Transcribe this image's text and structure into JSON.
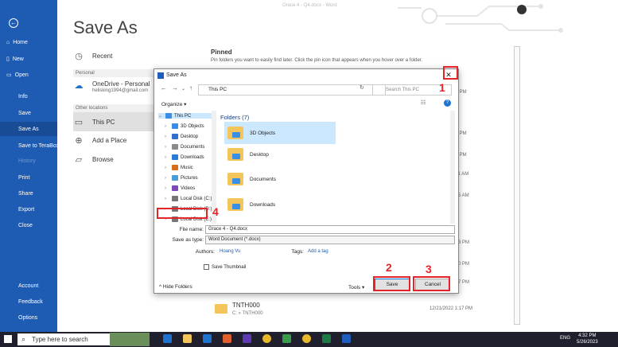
{
  "word": {
    "window_title": "Grace 4 - Q4.docx - Word",
    "page_title": "Save As",
    "sidebar": {
      "items": [
        {
          "label": "Home",
          "icon": "home-icon"
        },
        {
          "label": "New",
          "icon": "new-doc-icon"
        },
        {
          "label": "Open",
          "icon": "open-folder-icon"
        },
        {
          "label": "Info"
        },
        {
          "label": "Save"
        },
        {
          "label": "Save As"
        },
        {
          "label": "Save to TeraBox"
        },
        {
          "label": "History"
        },
        {
          "label": "Print"
        },
        {
          "label": "Share"
        },
        {
          "label": "Export"
        },
        {
          "label": "Close"
        },
        {
          "label": "Account"
        },
        {
          "label": "Feedback"
        },
        {
          "label": "Options"
        }
      ]
    },
    "locations": {
      "recent": "Recent",
      "personal_label": "Personal",
      "onedrive_name": "OneDrive - Personal",
      "onedrive_email": "helisking1994@gmail.com",
      "other_label": "Other locations",
      "this_pc": "This PC",
      "add_place": "Add a Place",
      "browse": "Browse"
    },
    "pinned": {
      "title": "Pinned",
      "subtitle": "Pin folders you want to easily find later. Click the pin icon that appears when you hover over a folder."
    },
    "side_times": [
      "... PM",
      "... PM",
      "... PM",
      ":11 AM",
      ":25 AM",
      ":13 PM",
      ":50 PM",
      ":17 PM"
    ],
    "recent_folder": {
      "name": "TNTH000",
      "path": "C: » TNTH000",
      "date": "12/21/2022 1:17 PM"
    }
  },
  "dialog": {
    "title": "Save As",
    "close": "✕",
    "address": "This PC",
    "search_placeholder": "Search This PC",
    "organize": "Organize ▾",
    "tree": [
      {
        "label": "This PC",
        "color": "#3a8ee6",
        "selected": true
      },
      {
        "label": "3D Objects",
        "color": "#3a8ee6"
      },
      {
        "label": "Desktop",
        "color": "#2f6fcf"
      },
      {
        "label": "Documents",
        "color": "#8a8a8a"
      },
      {
        "label": "Downloads",
        "color": "#2a7ad6"
      },
      {
        "label": "Music",
        "color": "#d86f1e"
      },
      {
        "label": "Pictures",
        "color": "#4a9cd6"
      },
      {
        "label": "Videos",
        "color": "#7b4ab8"
      },
      {
        "label": "Local Disk (C:)",
        "color": "#777777"
      },
      {
        "label": "Local Disk (D:)",
        "color": "#777777"
      },
      {
        "label": "Local Disk (E:)",
        "color": "#777777"
      }
    ],
    "folders_header": "Folders (7)",
    "folders": [
      "3D Objects",
      "Desktop",
      "Documents",
      "Downloads"
    ],
    "file_name_label": "File name:",
    "file_name_value": "Grace 4 - Q4.docx",
    "save_type_label": "Save as type:",
    "save_type_value": "Word Document (*.docx)",
    "authors_label": "Authors:",
    "authors_value": "Hoang Vu",
    "tags_label": "Tags:",
    "tags_value": "Add a tag",
    "thumbnail_label": "Save Thumbnail",
    "hide_folders": "Hide Folders",
    "tools": "Tools ▾",
    "save_button": "Save",
    "cancel_button": "Cancel"
  },
  "annotations": {
    "marks": [
      "1",
      "2",
      "3",
      "4"
    ],
    "color": "#e3242b"
  },
  "taskbar": {
    "search_placeholder": "Type here to search",
    "lang": "ENG",
    "time": "4:32 PM",
    "date": "5/26/2023"
  },
  "colors": {
    "word_blue": "#1e5cb3",
    "accent": "#0078d7"
  }
}
